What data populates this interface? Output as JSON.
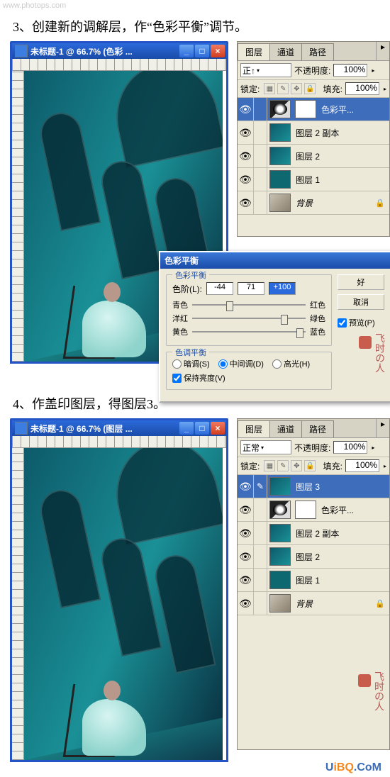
{
  "watermark": "www.photops.com",
  "steps": {
    "s3": "3、创建新的调解层，作“色彩平衡”调节。",
    "s4": "4、作盖印图层，得图层3。"
  },
  "doc_window": {
    "title1": "未标题-1 @ 66.7% (色彩 ...",
    "title2": "未标题-1 @ 66.7% (图层 ...",
    "min": "_",
    "max": "□",
    "close": "×",
    "hint": "www.photops.com"
  },
  "layers_panel": {
    "tabs": {
      "layers": "图层",
      "channels": "通道",
      "paths": "路径"
    },
    "blend_mode1": "正↑",
    "blend_mode2": "正常",
    "opacity_label": "不透明度:",
    "opacity_value": "100%",
    "lock_label": "锁定:",
    "fill_label": "填充:",
    "fill_value": "100%",
    "lock_icons": {
      "trans": "▦",
      "brush": "✎",
      "move": "✥",
      "lock": "🔒"
    },
    "eye": "👁",
    "brush": "✎",
    "items1": [
      {
        "type": "adj",
        "name": "色彩平...",
        "selected": true
      },
      {
        "type": "img",
        "name": "图层 2 副本"
      },
      {
        "type": "img",
        "name": "图层 2"
      },
      {
        "type": "solid",
        "name": "图层 1"
      },
      {
        "type": "bg",
        "name": "背景",
        "locked": true
      }
    ],
    "items2": [
      {
        "type": "img",
        "name": "图层 3",
        "selected": true
      },
      {
        "type": "adj",
        "name": "色彩平..."
      },
      {
        "type": "img",
        "name": "图层 2 副本"
      },
      {
        "type": "img",
        "name": "图层 2"
      },
      {
        "type": "solid",
        "name": "图层 1"
      },
      {
        "type": "bg",
        "name": "背景",
        "locked": true
      }
    ]
  },
  "color_balance": {
    "title": "色彩平衡",
    "group1": "色彩平衡",
    "levels_label": "色阶(L):",
    "values": {
      "v1": "-44",
      "v2": "71",
      "v3": "+100"
    },
    "rows": [
      {
        "left": "青色",
        "right": "红色",
        "pos": 30
      },
      {
        "left": "洋红",
        "right": "绿色",
        "pos": 78
      },
      {
        "left": "黄色",
        "right": "蓝色",
        "pos": 92
      }
    ],
    "group2": "色调平衡",
    "radios": {
      "shadows": "暗调(S)",
      "midtones": "中间调(D)",
      "highlights": "高光(H)"
    },
    "preserve": "保持亮度(V)",
    "btn_ok": "好",
    "btn_cancel": "取消",
    "preview": "预览(P)"
  },
  "stamp": "飞时の人",
  "footer": {
    "u": "U",
    "i": "i",
    "bq": "BQ",
    "com": ".CoM"
  }
}
